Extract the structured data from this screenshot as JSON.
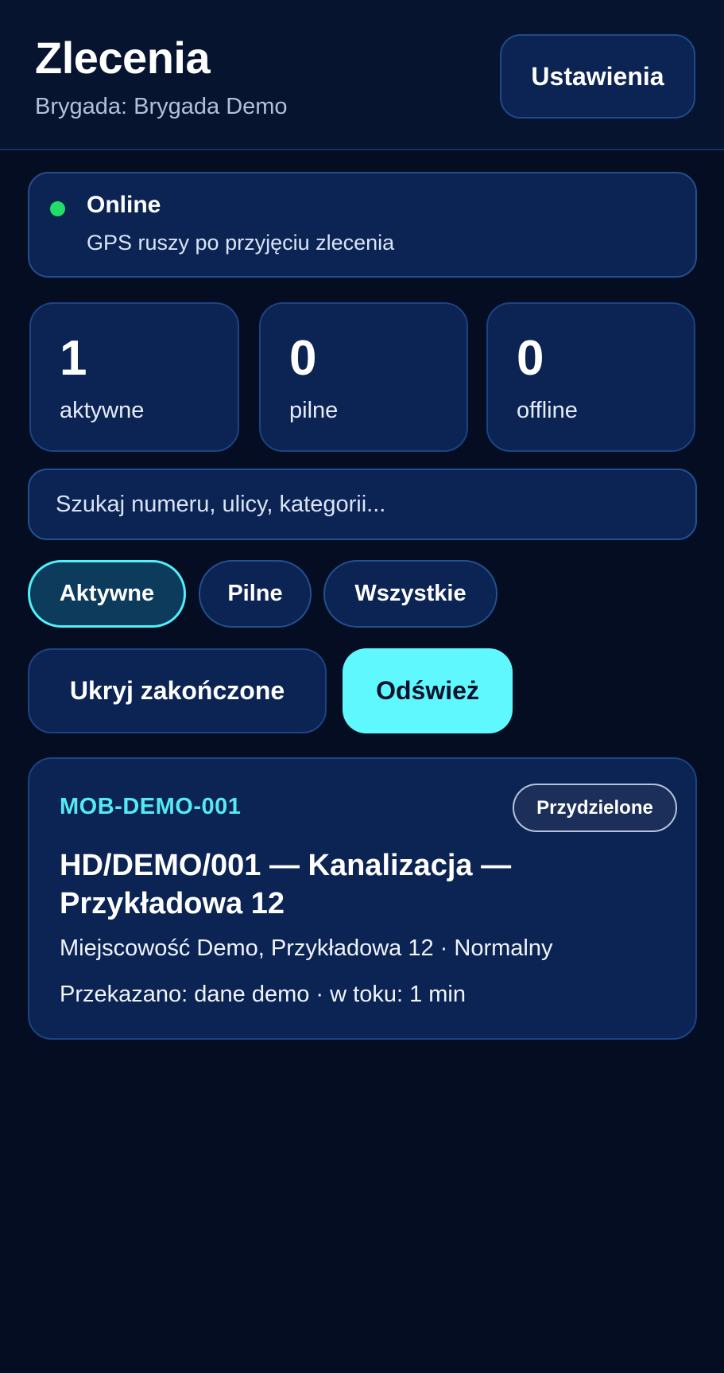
{
  "header": {
    "title": "Zlecenia",
    "subtitle": "Brygada: Brygada Demo",
    "settings_label": "Ustawienia"
  },
  "status": {
    "title": "Online",
    "subtitle": "GPS ruszy po przyjęciu zlecenia",
    "dot_color": "#22dd6a"
  },
  "stats": [
    {
      "value": "1",
      "label": "aktywne"
    },
    {
      "value": "0",
      "label": "pilne"
    },
    {
      "value": "0",
      "label": "offline"
    }
  ],
  "search": {
    "placeholder": "Szukaj numeru, ulicy, kategorii...",
    "value": ""
  },
  "filters": [
    {
      "label": "Aktywne",
      "active": true
    },
    {
      "label": "Pilne",
      "active": false
    },
    {
      "label": "Wszystkie",
      "active": false
    }
  ],
  "actions": {
    "hide_label": "Ukryj zakończone",
    "refresh_label": "Odśwież"
  },
  "orders": [
    {
      "code": "MOB-DEMO-001",
      "status": "Przydzielone",
      "title": "HD/DEMO/001 — Kanalizacja — Przykładowa 12",
      "meta": "Miejscowość Demo, Przykładowa 12 · Normalny",
      "info": "Przekazano: dane demo · w toku: 1 min"
    }
  ],
  "colors": {
    "background": "#040d22",
    "card": "#0b2454",
    "accent": "#5ff8fe",
    "code": "#56e8f5"
  }
}
